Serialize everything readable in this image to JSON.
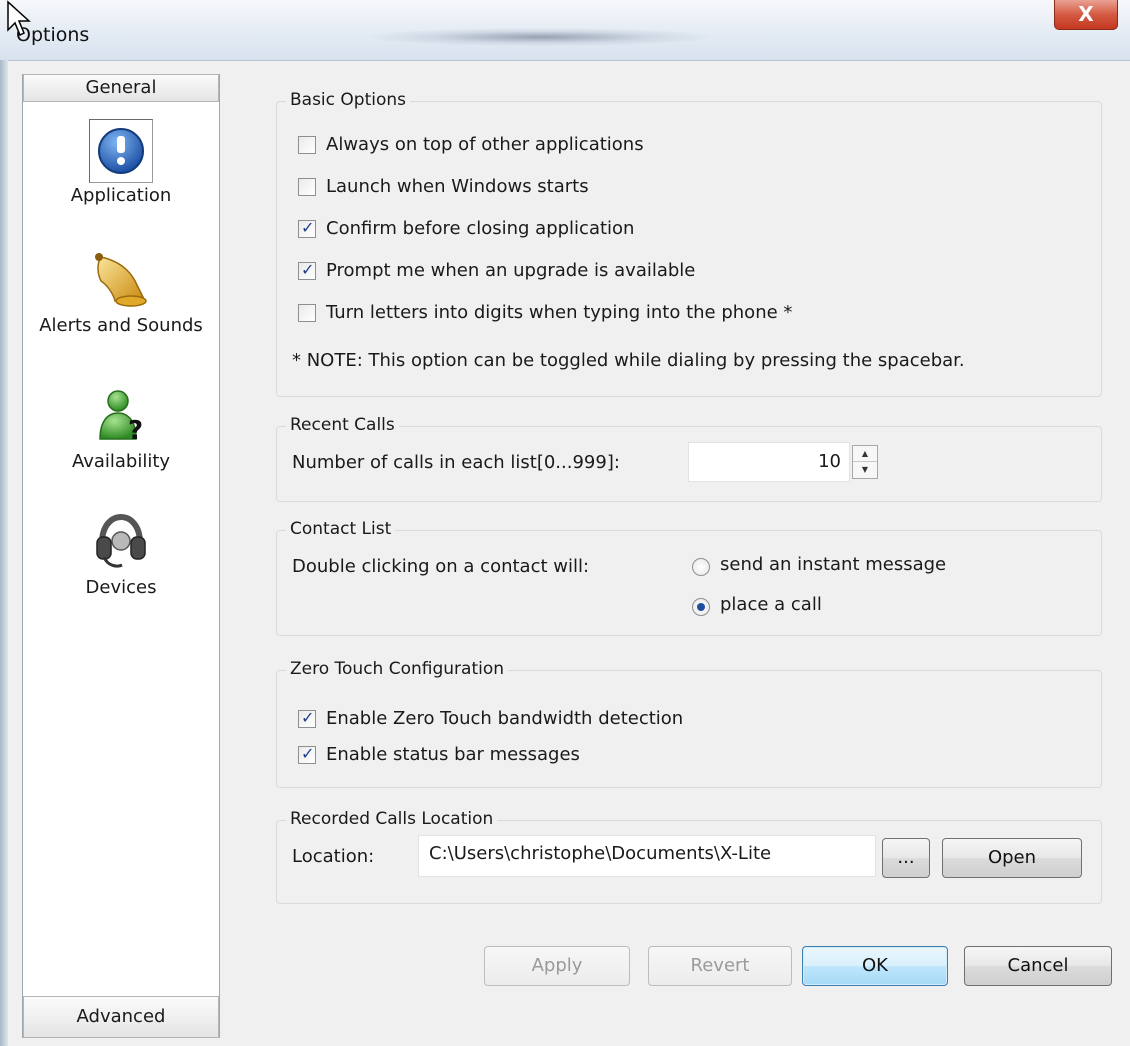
{
  "window": {
    "title": "Options",
    "close_glyph": "X"
  },
  "sidebar": {
    "header_general": "General",
    "header_advanced": "Advanced",
    "items": [
      {
        "label": "Application",
        "icon": "info-icon",
        "selected": true
      },
      {
        "label": "Alerts and Sounds",
        "icon": "bell-icon",
        "selected": false
      },
      {
        "label": "Availability",
        "icon": "availability-icon",
        "selected": false
      },
      {
        "label": "Devices",
        "icon": "headset-icon",
        "selected": false
      }
    ]
  },
  "basic_options": {
    "title": "Basic Options",
    "options": [
      {
        "label": "Always on top of other applications",
        "checked": false
      },
      {
        "label": "Launch when Windows starts",
        "checked": false
      },
      {
        "label": "Confirm before closing application",
        "checked": true
      },
      {
        "label": "Prompt me when an upgrade is available",
        "checked": true
      },
      {
        "label": "Turn letters into digits when typing into the phone *",
        "checked": false
      }
    ],
    "note": "* NOTE: This option can be toggled while dialing by pressing the spacebar."
  },
  "recent_calls": {
    "title": "Recent Calls",
    "label": "Number of calls in each list[0...999]:",
    "value": "10"
  },
  "contact_list": {
    "title": "Contact List",
    "label": "Double clicking on a contact will:",
    "options": [
      {
        "label": "send an instant message",
        "selected": false
      },
      {
        "label": "place a call",
        "selected": true
      }
    ]
  },
  "zero_touch": {
    "title": "Zero Touch Configuration",
    "options": [
      {
        "label": "Enable Zero Touch bandwidth detection",
        "checked": true
      },
      {
        "label": "Enable status bar messages",
        "checked": true
      }
    ]
  },
  "recorded_calls": {
    "title": "Recorded Calls Location",
    "label": "Location:",
    "value": "C:\\Users\\christophe\\Documents\\X-Lite",
    "browse_label": "...",
    "open_label": "Open"
  },
  "footer": {
    "apply": "Apply",
    "revert": "Revert",
    "ok": "OK",
    "cancel": "Cancel"
  },
  "colors": {
    "default_button": "#a7d9f5",
    "close_button": "#c4381f",
    "check_mark": "#1e3f88"
  }
}
